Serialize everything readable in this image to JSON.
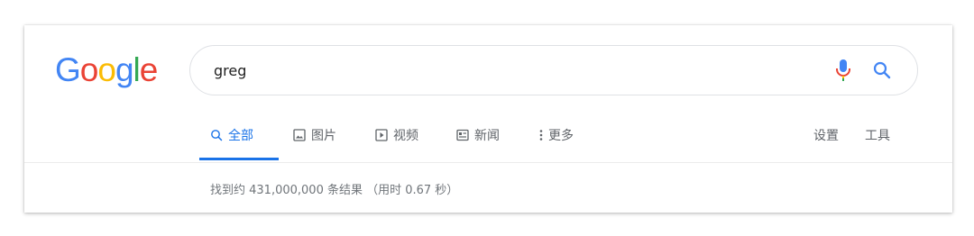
{
  "logo": {
    "letters": [
      {
        "char": "G",
        "color": "#4285F4"
      },
      {
        "char": "o",
        "color": "#EA4335"
      },
      {
        "char": "o",
        "color": "#FBBC05"
      },
      {
        "char": "g",
        "color": "#4285F4"
      },
      {
        "char": "l",
        "color": "#34A853"
      },
      {
        "char": "e",
        "color": "#EA4335"
      }
    ]
  },
  "search": {
    "query": "greg",
    "mic_icon": "microphone-icon",
    "search_icon": "magnifier-icon"
  },
  "tabs": [
    {
      "label": "全部",
      "icon": "search-icon",
      "active": true
    },
    {
      "label": "图片",
      "icon": "image-icon",
      "active": false
    },
    {
      "label": "视频",
      "icon": "video-icon",
      "active": false
    },
    {
      "label": "新闻",
      "icon": "news-icon",
      "active": false
    },
    {
      "label": "更多",
      "icon": "more-vert-icon",
      "active": false
    }
  ],
  "right_links": {
    "settings": "设置",
    "tools": "工具"
  },
  "results_stats": "找到约 431,000,000 条结果 （用时 0.67 秒）",
  "colors": {
    "accent": "#1a73e8",
    "muted": "#5f6368"
  }
}
